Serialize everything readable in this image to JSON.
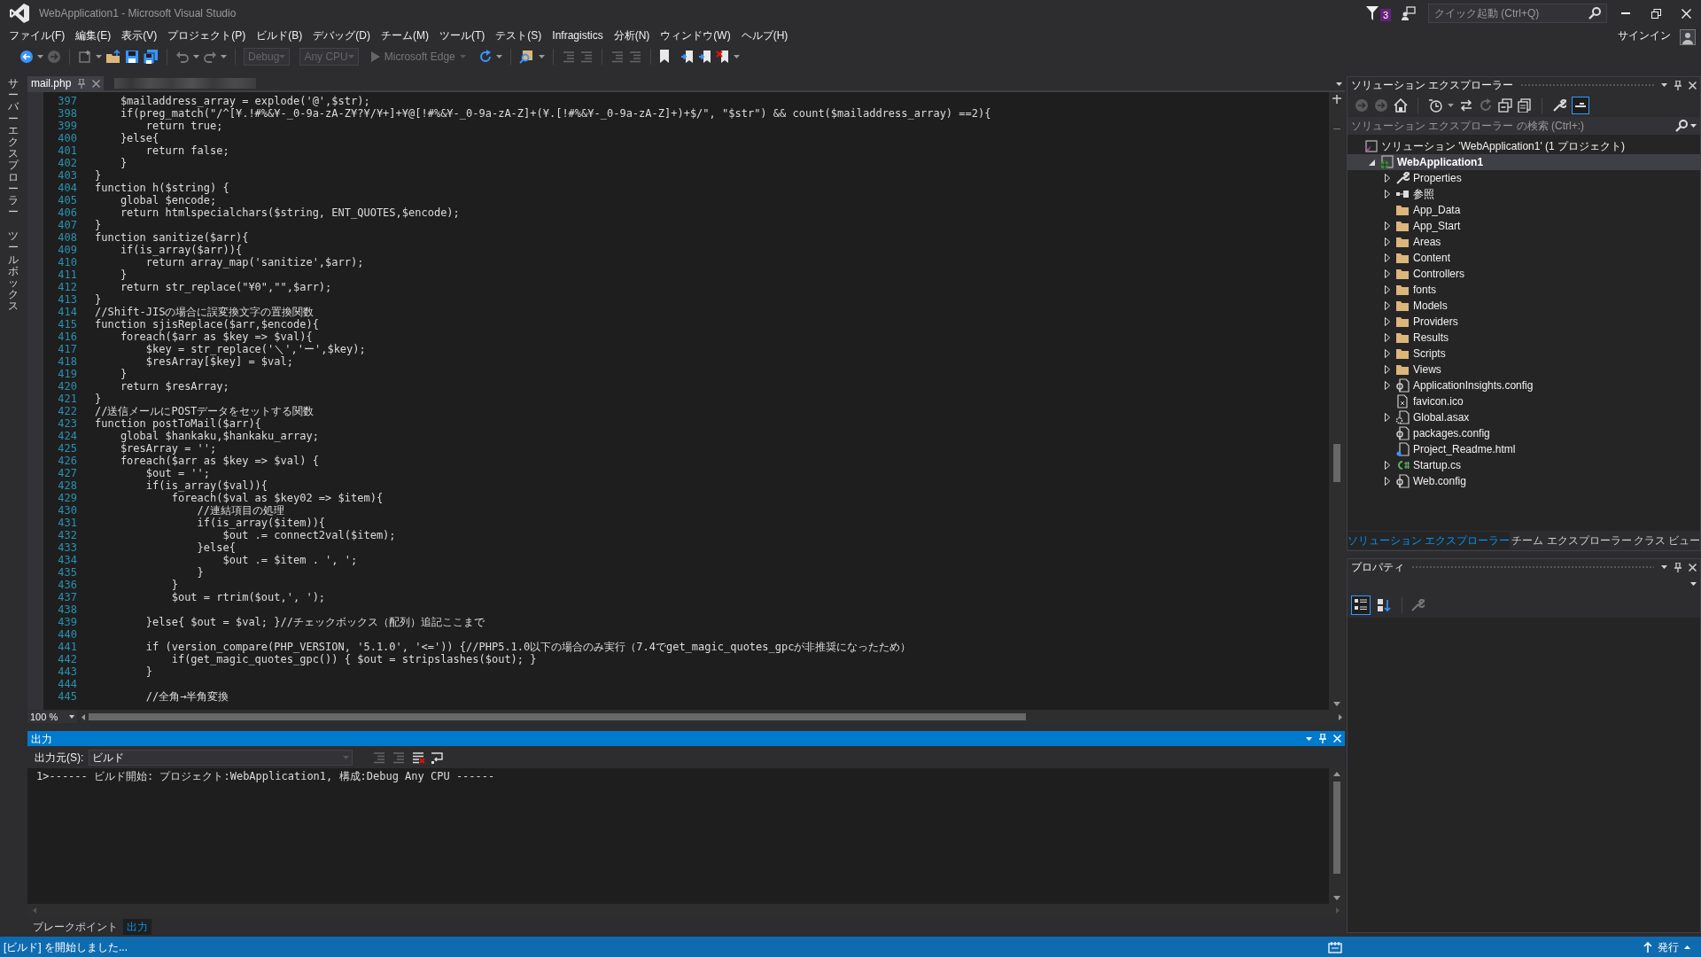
{
  "window": {
    "title": "WebApplication1 - Microsoft Visual Studio"
  },
  "title_bar": {
    "notification_count": "3",
    "quick_launch": {
      "placeholder": "クイック起動 (Ctrl+Q)"
    }
  },
  "menu_bar": {
    "items": [
      "ファイル(F)",
      "編集(E)",
      "表示(V)",
      "プロジェクト(P)",
      "ビルド(B)",
      "デバッグ(D)",
      "チーム(M)",
      "ツール(T)",
      "テスト(S)",
      "Infragistics",
      "分析(N)",
      "ウィンドウ(W)",
      "ヘルプ(H)"
    ],
    "sign_in": "サインイン"
  },
  "toolbar": {
    "configuration": {
      "value": "Debug",
      "disabled": true
    },
    "platform": {
      "value": "Any CPU",
      "disabled": true
    },
    "run_target": {
      "label": "Microsoft Edge",
      "disabled": true
    }
  },
  "side_tabs": [
    "サーバーエクスプローラー",
    "ツールボックス"
  ],
  "editor": {
    "tabs": [
      {
        "label": "mail.php",
        "selected": true
      }
    ],
    "zoom": "100 %",
    "lines": [
      {
        "number": "397",
        "code": "    $mailaddress_array = explode('@',$str);"
      },
      {
        "number": "398",
        "code": "    if(preg_match(\"/^[¥.!#%&¥-_0-9a-zA-Z¥?¥/¥+]+¥@[!#%&¥-_0-9a-zA-Z]+(¥.[!#%&¥-_0-9a-zA-Z]+)+$/\", \"$str\") && count($mailaddress_array) ==2){"
      },
      {
        "number": "399",
        "code": "        return true;"
      },
      {
        "number": "400",
        "code": "    }else{"
      },
      {
        "number": "401",
        "code": "        return false;"
      },
      {
        "number": "402",
        "code": "    }"
      },
      {
        "number": "403",
        "code": "}"
      },
      {
        "number": "404",
        "code": "function h($string) {"
      },
      {
        "number": "405",
        "code": "    global $encode;"
      },
      {
        "number": "406",
        "code": "    return htmlspecialchars($string, ENT_QUOTES,$encode);"
      },
      {
        "number": "407",
        "code": "}"
      },
      {
        "number": "408",
        "code": "function sanitize($arr){"
      },
      {
        "number": "409",
        "code": "    if(is_array($arr)){"
      },
      {
        "number": "410",
        "code": "        return array_map('sanitize',$arr);"
      },
      {
        "number": "411",
        "code": "    }"
      },
      {
        "number": "412",
        "code": "    return str_replace(\"¥0\",\"\",$arr);"
      },
      {
        "number": "413",
        "code": "}"
      },
      {
        "number": "414",
        "code": "//Shift-JISの場合に誤変換文字の置換関数"
      },
      {
        "number": "415",
        "code": "function sjisReplace($arr,$encode){"
      },
      {
        "number": "416",
        "code": "    foreach($arr as $key => $val){"
      },
      {
        "number": "417",
        "code": "        $key = str_replace('＼','ー',$key);"
      },
      {
        "number": "418",
        "code": "        $resArray[$key] = $val;"
      },
      {
        "number": "419",
        "code": "    }"
      },
      {
        "number": "420",
        "code": "    return $resArray;"
      },
      {
        "number": "421",
        "code": "}"
      },
      {
        "number": "422",
        "code": "//送信メールにPOSTデータをセットする関数"
      },
      {
        "number": "423",
        "code": "function postToMail($arr){"
      },
      {
        "number": "424",
        "code": "    global $hankaku,$hankaku_array;"
      },
      {
        "number": "425",
        "code": "    $resArray = '';"
      },
      {
        "number": "426",
        "code": "    foreach($arr as $key => $val) {"
      },
      {
        "number": "427",
        "code": "        $out = '';"
      },
      {
        "number": "428",
        "code": "        if(is_array($val)){"
      },
      {
        "number": "429",
        "code": "            foreach($val as $key02 => $item){"
      },
      {
        "number": "430",
        "code": "                //連結項目の処理"
      },
      {
        "number": "431",
        "code": "                if(is_array($item)){"
      },
      {
        "number": "432",
        "code": "                    $out .= connect2val($item);"
      },
      {
        "number": "433",
        "code": "                }else{"
      },
      {
        "number": "434",
        "code": "                    $out .= $item . ', ';"
      },
      {
        "number": "435",
        "code": "                }"
      },
      {
        "number": "436",
        "code": "            }"
      },
      {
        "number": "437",
        "code": "            $out = rtrim($out,', ');"
      },
      {
        "number": "438"
      },
      {
        "number": "439",
        "code": "        }else{ $out = $val; }//チェックボックス（配列）追記ここまで"
      },
      {
        "number": "440"
      },
      {
        "number": "441",
        "code": "        if (version_compare(PHP_VERSION, '5.1.0', '<=')) {//PHP5.1.0以下の場合のみ実行（7.4でget_magic_quotes_gpcが非推奨になったため）"
      },
      {
        "number": "442",
        "code": "            if(get_magic_quotes_gpc()) { $out = stripslashes($out); }"
      },
      {
        "number": "443",
        "code": "        }"
      },
      {
        "number": "444"
      },
      {
        "number": "445",
        "code": "        //全角→半角変換"
      }
    ]
  },
  "output": {
    "title": "出力",
    "source_label": "出力元(S):",
    "source": "ビルド",
    "lines": [
      "1>------ ビルド開始: プロジェクト:WebApplication1, 構成:Debug Any CPU ------"
    ],
    "tabs": [
      {
        "label": "ブレークポイント",
        "selected": false
      },
      {
        "label": "出力",
        "selected": true
      }
    ]
  },
  "solution_explorer": {
    "title": "ソリューション エクスプローラー",
    "preview_toggle": {
      "on": true
    },
    "search": {
      "placeholder": "ソリューション エクスプローラー の検索 (Ctrl+:)"
    },
    "tree": [
      {
        "label": "ソリューション 'WebApplication1' (1 プロジェクト)",
        "kind": "solution",
        "selected": false,
        "children": [
          {
            "label": "WebApplication1",
            "kind": "project",
            "expanded": true,
            "selected": true,
            "children": [
              {
                "label": "Properties",
                "kind": "wrench",
                "expanded": false,
                "selected": false
              },
              {
                "label": "参照",
                "kind": "references",
                "expanded": false,
                "selected": false
              },
              {
                "label": "App_Data",
                "kind": "folder",
                "selected": false
              },
              {
                "label": "App_Start",
                "kind": "folder",
                "expanded": false,
                "selected": false
              },
              {
                "label": "Areas",
                "kind": "folder",
                "expanded": false,
                "selected": false
              },
              {
                "label": "Content",
                "kind": "folder",
                "expanded": false,
                "selected": false
              },
              {
                "label": "Controllers",
                "kind": "folder",
                "expanded": false,
                "selected": false
              },
              {
                "label": "fonts",
                "kind": "folder",
                "expanded": false,
                "selected": false
              },
              {
                "label": "Models",
                "kind": "folder",
                "expanded": false,
                "selected": false
              },
              {
                "label": "Providers",
                "kind": "folder",
                "expanded": false,
                "selected": false
              },
              {
                "label": "Results",
                "kind": "folder",
                "expanded": false,
                "selected": false
              },
              {
                "label": "Scripts",
                "kind": "folder",
                "expanded": false,
                "selected": false
              },
              {
                "label": "Views",
                "kind": "folder",
                "expanded": false,
                "selected": false
              },
              {
                "label": "ApplicationInsights.config",
                "kind": "config",
                "expanded": false,
                "selected": false
              },
              {
                "label": "favicon.ico",
                "kind": "image",
                "selected": false
              },
              {
                "label": "Global.asax",
                "kind": "asax",
                "expanded": false,
                "selected": false
              },
              {
                "label": "packages.config",
                "kind": "config",
                "selected": false
              },
              {
                "label": "Project_Readme.html",
                "kind": "html",
                "selected": false
              },
              {
                "label": "Startup.cs",
                "kind": "csharp",
                "expanded": false,
                "selected": false
              },
              {
                "label": "Web.config",
                "kind": "config",
                "expanded": false,
                "selected": false
              }
            ]
          }
        ]
      }
    ],
    "tabs": [
      {
        "label": "ソリューション エクスプローラー",
        "selected": true
      },
      {
        "label": "チーム エクスプローラー",
        "selected": false
      },
      {
        "label": "クラス ビュー",
        "selected": false
      }
    ]
  },
  "properties": {
    "title": "プロパティ",
    "categorized_view": true
  },
  "status_bar": {
    "message": "[ビルド] を開始しました...",
    "publish": "発行"
  }
}
